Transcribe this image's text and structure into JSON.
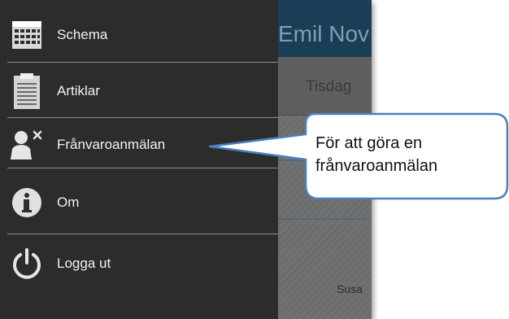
{
  "app": {
    "title": "Emil Nov",
    "day": "Tisdag",
    "visible_name": "Susa",
    "colors": {
      "topbar": "#1a3e56",
      "drawer": "#2c2c2c"
    }
  },
  "drawer": {
    "items": [
      {
        "label": "Schema",
        "icon": "calendar-icon"
      },
      {
        "label": "Artiklar",
        "icon": "clipboard-icon"
      },
      {
        "label": "Frånvaroanmälan",
        "icon": "person-remove-icon"
      },
      {
        "label": "Om",
        "icon": "info-icon"
      },
      {
        "label": "Logga ut",
        "icon": "power-icon"
      }
    ]
  },
  "callout": {
    "line1": "För att göra en",
    "line2": "frånvaroanmälan",
    "colors": {
      "border": "#4a7fc0",
      "fill": "#ffffff"
    }
  }
}
